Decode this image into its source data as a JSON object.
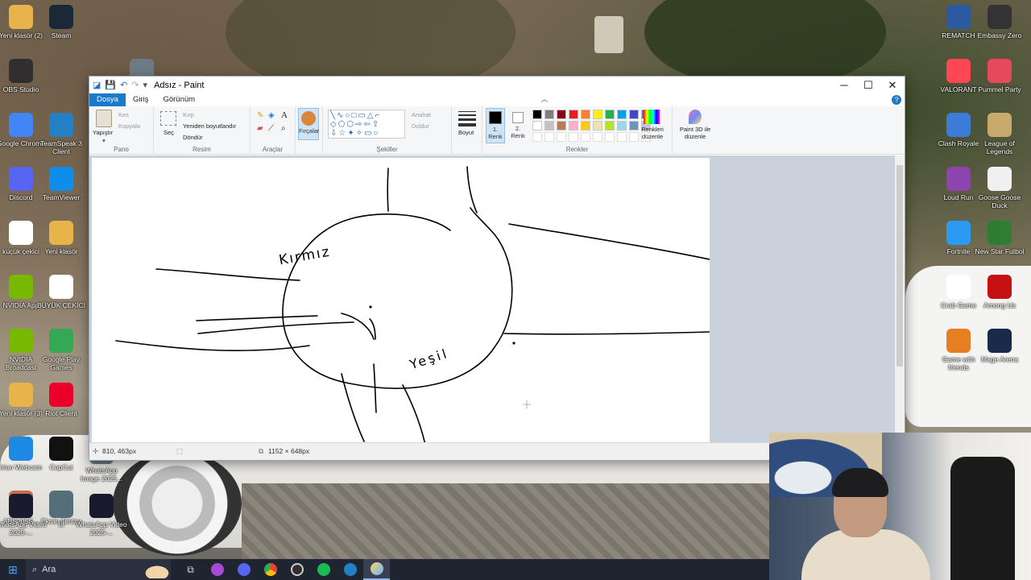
{
  "desktop": {
    "icons_left": [
      {
        "label": "Yeni klasör (2)",
        "color": "#e8b34a"
      },
      {
        "label": "Steam",
        "color": "#1b2838"
      },
      {
        "label": "OBS Studio",
        "color": "#302e31"
      },
      {
        "label": "WhatsApp Image 2025...",
        "color": "#6d7b85"
      },
      {
        "label": "Google Chrome",
        "color": "#4285f4"
      },
      {
        "label": "TeamSpeak 3 Client",
        "color": "#2580c3"
      },
      {
        "label": "Discord",
        "color": "#5865f2"
      },
      {
        "label": "TeamViewer",
        "color": "#0e8ee9"
      },
      {
        "label": "küçük çekici",
        "color": "#ffffff"
      },
      {
        "label": "Yeni klasör",
        "color": "#e8b34a"
      },
      {
        "label": "NVIDIA App",
        "color": "#76b900"
      },
      {
        "label": "BÜYÜK ÇEKİCİ",
        "color": "#ffffff"
      },
      {
        "label": "NVIDIA Broadcast",
        "color": "#76b900"
      },
      {
        "label": "Google Play Games",
        "color": "#34a853"
      },
      {
        "label": "Yeni klasör (3)",
        "color": "#e8b34a"
      },
      {
        "label": "Riot Client",
        "color": "#eb0029"
      },
      {
        "label": "Iriun Webcam",
        "color": "#1e88e5"
      },
      {
        "label": "CapCut",
        "color": "#111111"
      },
      {
        "label": "ABS205S...",
        "color": "#c96b52"
      },
      {
        "label": "Ekran Alıntısı",
        "color": "#546e7a"
      },
      {
        "label": "WhatsApp Image 2025...",
        "color": "#6d7b85"
      },
      {
        "label": "WhatsApp Video 2025-...",
        "color": "#1a1a2e"
      },
      {
        "label": "III",
        "color": "#546e7a"
      },
      {
        "label": "WhatsApp Video 2025-...",
        "color": "#1a1a2e"
      }
    ],
    "icons_right": [
      {
        "label": "REMATCH",
        "color": "#2c5aa0"
      },
      {
        "label": "Embassy Zero",
        "color": "#333333"
      },
      {
        "label": "VALORANT",
        "color": "#ff4655"
      },
      {
        "label": "Pummel Party",
        "color": "#e64a5a"
      },
      {
        "label": "Clash Royale",
        "color": "#3d7bd9"
      },
      {
        "label": "League of Legends",
        "color": "#c8aa6e"
      },
      {
        "label": "Loud Run",
        "color": "#8e44ad"
      },
      {
        "label": "Goose Goose Duck",
        "color": "#f0f0f0"
      },
      {
        "label": "Fortnite",
        "color": "#2b9af3"
      },
      {
        "label": "New Star Futbol",
        "color": "#2e7d32"
      },
      {
        "label": "Crab Game",
        "color": "#ffffff"
      },
      {
        "label": "Among Us",
        "color": "#c51111"
      },
      {
        "label": "Game with friends",
        "color": "#e67e22"
      },
      {
        "label": "Mage Arena",
        "color": "#1a2a4a"
      }
    ]
  },
  "paint": {
    "title": "Adsız - Paint",
    "menu": {
      "file": "Dosya",
      "home": "Giriş",
      "view": "Görünüm"
    },
    "groups": {
      "clipboard": {
        "label": "Pano",
        "paste": "Yapıştır",
        "cut": "Kes",
        "copy": "Kopyala"
      },
      "image": {
        "label": "Resim",
        "select": "Seç",
        "crop": "Kırp",
        "resize": "Yeniden boyutlandır",
        "rotate": "Döndür"
      },
      "tools": {
        "label": "Araçlar"
      },
      "brushes": {
        "label": "Fırçalar"
      },
      "shapes": {
        "label": "Şekiller",
        "outline": "Anahat",
        "fill": "Doldur"
      },
      "size": {
        "label": "Boyut"
      },
      "colors": {
        "label": "Renkler",
        "color1": "1. Renk",
        "color2": "2. Renk",
        "edit": "Renkleri düzenle",
        "palette_row1": [
          "#000000",
          "#7f7f7f",
          "#880015",
          "#ed1c24",
          "#ff7f27",
          "#fff200",
          "#22b14c",
          "#00a2e8",
          "#3f48cc",
          "#a349a4"
        ],
        "palette_row2": [
          "#ffffff",
          "#c3c3c3",
          "#b97a57",
          "#ffaec9",
          "#ffc90e",
          "#efe4b0",
          "#b5e61d",
          "#99d9ea",
          "#7092be",
          "#c8bfe7"
        ]
      },
      "paint3d": {
        "label": "Paint 3D ile düzenle"
      }
    },
    "canvas": {
      "labels": {
        "north_west": "Kırmız",
        "south": "Yeşil"
      }
    },
    "status": {
      "cursor": "810, 463px",
      "canvas_size": "1152 × 648px"
    }
  },
  "taskbar": {
    "search_placeholder": "Ara"
  }
}
